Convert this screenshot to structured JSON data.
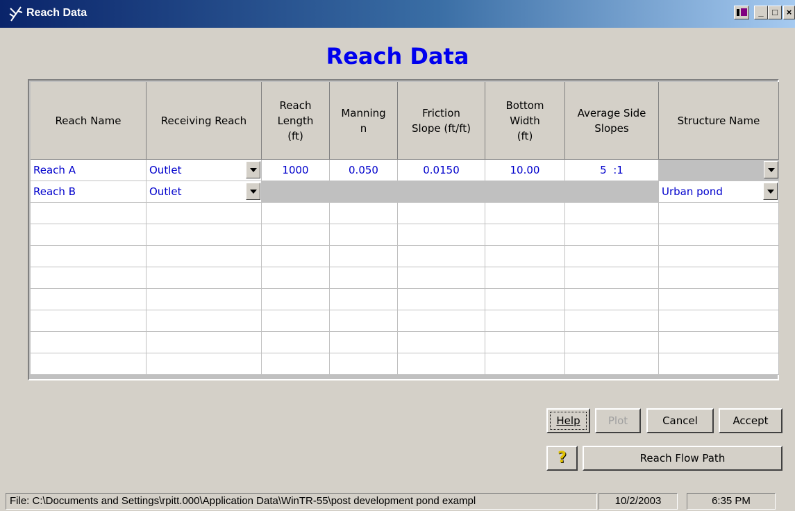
{
  "window": {
    "title": "Reach Data",
    "controls": {
      "minimize": "_",
      "maximize": "□",
      "close": "×"
    }
  },
  "heading": "Reach Data",
  "grid": {
    "columns": [
      "Reach Name",
      "Receiving Reach",
      "Reach\nLength\n(ft)",
      "Manning\nn",
      "Friction\nSlope (ft/ft)",
      "Bottom\nWidth\n(ft)",
      "Average Side\nSlopes",
      "Structure Name"
    ],
    "rows": [
      {
        "reach_name": "Reach A",
        "receiving_reach": "Outlet",
        "length": "1000",
        "manning": "0.050",
        "slope": "0.0150",
        "width": "10.00",
        "side_slopes": "5  :1",
        "structure": ""
      },
      {
        "reach_name": "Reach B",
        "receiving_reach": "Outlet",
        "structure": "Urban pond"
      }
    ]
  },
  "buttons": {
    "help": "Help",
    "plot": "Plot",
    "cancel": "Cancel",
    "accept": "Accept",
    "flow_path": "Reach Flow Path"
  },
  "status_bar": {
    "file": "File: C:\\Documents and Settings\\rpitt.000\\Application Data\\WinTR-55\\post development pond exampl",
    "date": "10/2/2003",
    "time": "6:35 PM"
  }
}
